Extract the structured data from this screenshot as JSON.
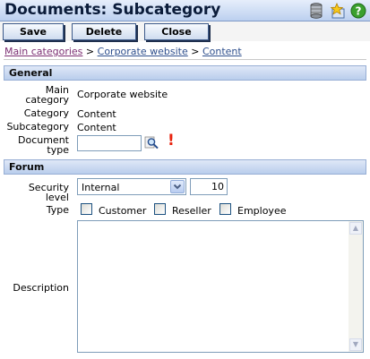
{
  "window": {
    "title": "Documents: Subcategory"
  },
  "title_icons": [
    "database-icon",
    "favorite-star-icon",
    "help-icon"
  ],
  "toolbar": {
    "save": "Save",
    "delete": "Delete",
    "close": "Close"
  },
  "breadcrumb": {
    "items": [
      "Main categories",
      "Corporate website",
      "Content"
    ],
    "separator": ">"
  },
  "general": {
    "header": "General",
    "main_category_label_1": "Main",
    "main_category_label_2": "category",
    "main_category": "Corporate website",
    "category_label": "Category",
    "category": "Content",
    "subcategory_label": "Subcategory",
    "subcategory": "Content",
    "document_type_label_1": "Document",
    "document_type_label_2": "type",
    "document_type_value": "",
    "required_marker": "!"
  },
  "forum": {
    "header": "Forum",
    "security_level_label": "Security level",
    "security_level_selected": "Internal",
    "security_level_number": "10",
    "type_label": "Type",
    "type_options": [
      "Customer",
      "Reseller",
      "Employee"
    ],
    "description_label": "Description",
    "description_value": ""
  },
  "colors": {
    "section_header": "#c4d6f1",
    "link": "#2e4f8d",
    "visited_link": "#7b2d72",
    "required": "#e8230e"
  }
}
